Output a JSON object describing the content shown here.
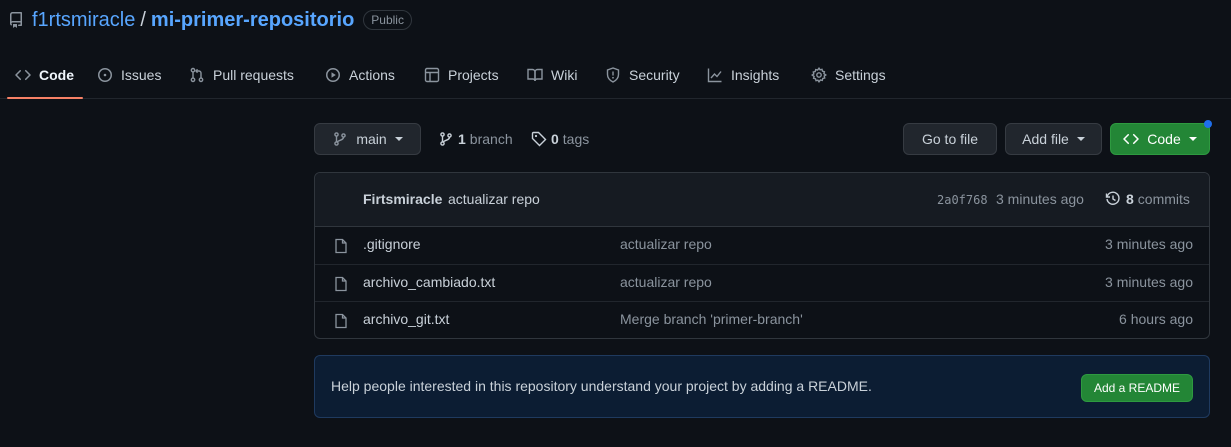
{
  "colors": {
    "background": "#0d1117",
    "link": "#58a6ff",
    "accent_underline": "#f78166",
    "green": "#238636",
    "notification": "#1f6feb"
  },
  "repo": {
    "icon": "repo-icon",
    "owner": "f1rtsmiracle",
    "separator": "/",
    "name": "mi-primer-repositorio",
    "visibility": "Public"
  },
  "tabs": [
    {
      "label": "Code",
      "icon": "code-icon",
      "active": true
    },
    {
      "label": "Issues",
      "icon": "issue-icon"
    },
    {
      "label": "Pull requests",
      "icon": "pull-request-icon"
    },
    {
      "label": "Actions",
      "icon": "play-icon"
    },
    {
      "label": "Projects",
      "icon": "table-icon"
    },
    {
      "label": "Wiki",
      "icon": "book-icon"
    },
    {
      "label": "Security",
      "icon": "shield-icon"
    },
    {
      "label": "Insights",
      "icon": "graph-icon"
    },
    {
      "label": "Settings",
      "icon": "gear-icon"
    }
  ],
  "controls": {
    "branch_selector": "main",
    "branches_count": "1",
    "branches_label": "branch",
    "tags_count": "0",
    "tags_label": "tags",
    "go_to_file": "Go to file",
    "add_file": "Add file",
    "code_button": "Code"
  },
  "latest_commit": {
    "author": "Firtsmiracle",
    "message": "actualizar repo",
    "sha": "2a0f768",
    "time": "3 minutes ago",
    "commits_count": "8",
    "commits_label": "commits"
  },
  "files": [
    {
      "name": ".gitignore",
      "commit_message": "actualizar repo",
      "time": "3 minutes ago"
    },
    {
      "name": "archivo_cambiado.txt",
      "commit_message": "actualizar repo",
      "time": "3 minutes ago"
    },
    {
      "name": "archivo_git.txt",
      "commit_message": "Merge branch 'primer-branch'",
      "time": "6 hours ago"
    }
  ],
  "readme_banner": {
    "text": "Help people interested in this repository understand your project by adding a README.",
    "button": "Add a README"
  }
}
